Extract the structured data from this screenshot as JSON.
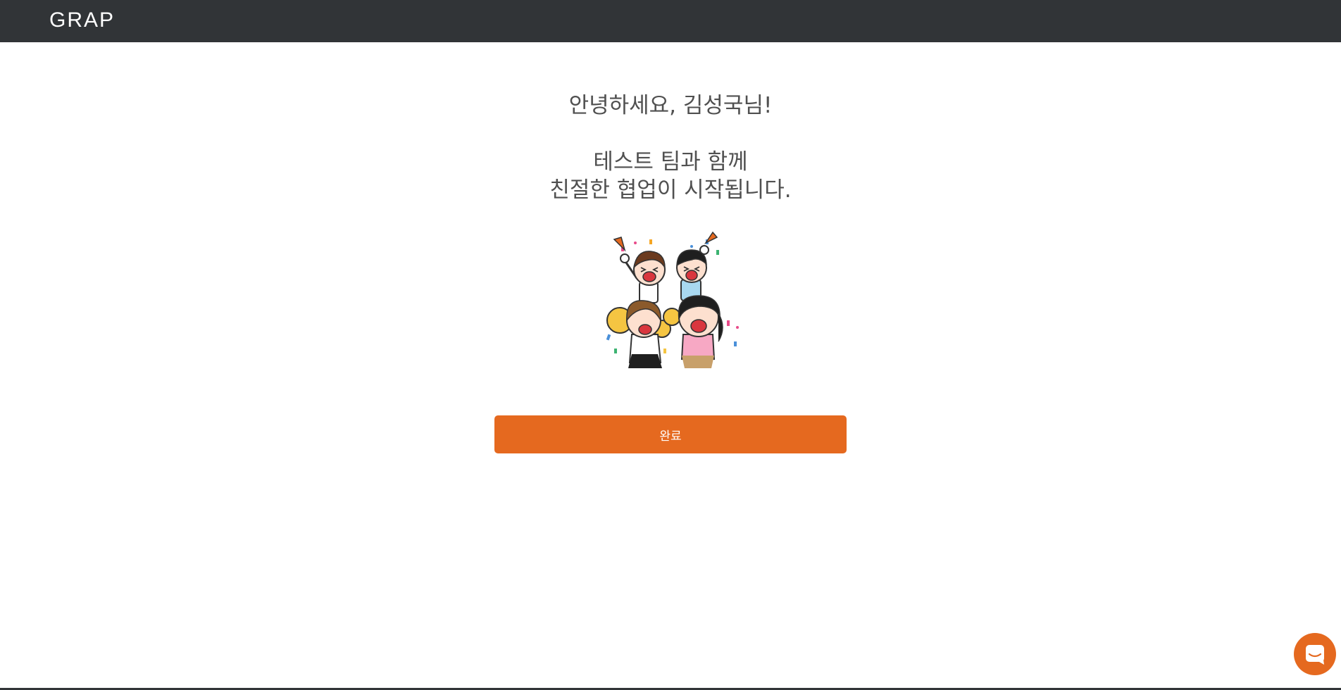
{
  "header": {
    "logo_text": "GRAP"
  },
  "main": {
    "greeting": "안녕하세요, 김성국님!",
    "message_line1": "테스트 팀과 함께",
    "message_line2": "친절한 협업이 시작됩니다.",
    "illustration_icon": "celebrating-team-illustration",
    "done_label": "완료"
  },
  "chat": {
    "icon": "chat-bubble-icon"
  },
  "colors": {
    "topbar": "#313437",
    "accent": "#e5691f",
    "text": "#505050"
  }
}
